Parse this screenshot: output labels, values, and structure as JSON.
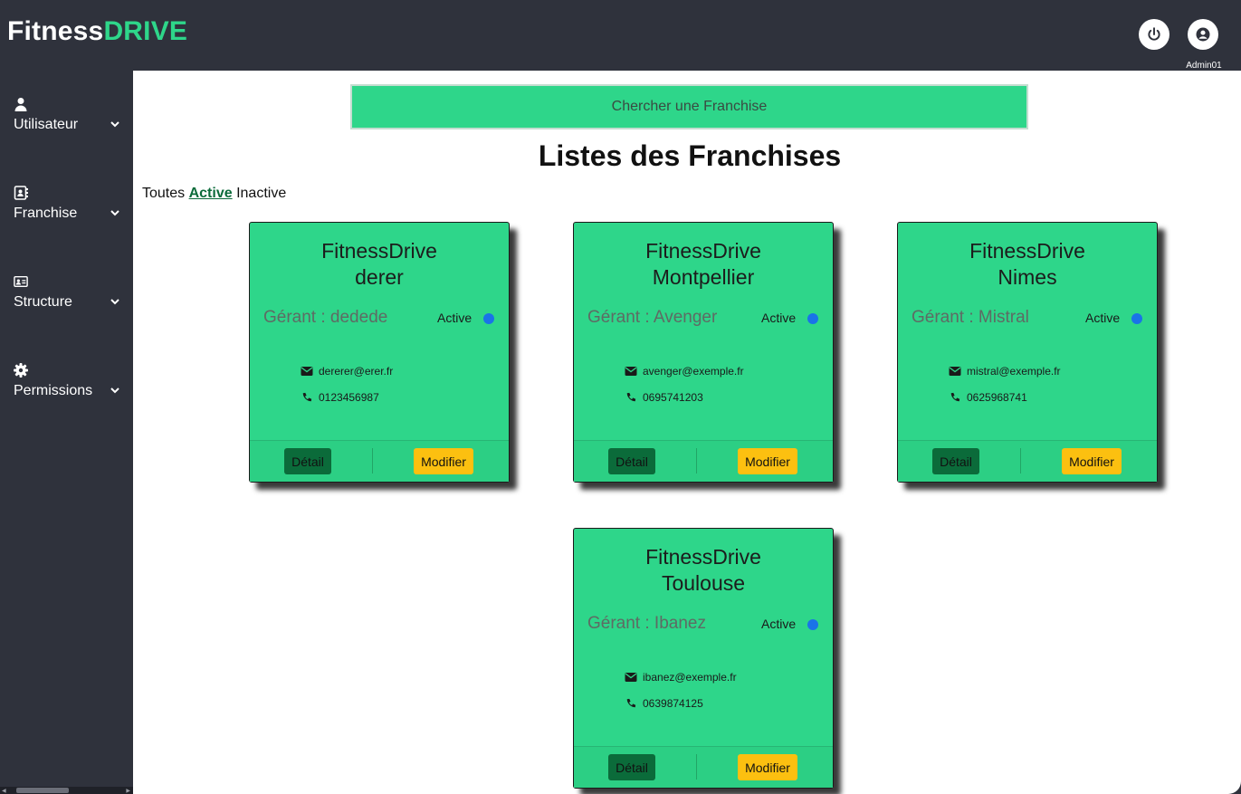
{
  "header": {
    "logo_part1": "Fitness",
    "logo_part2": "DRIVE",
    "power_icon": "power-icon",
    "user_icon": "user-circle-icon",
    "username": "Admin01"
  },
  "sidebar": {
    "items": [
      {
        "label": "Utilisateur",
        "icon": "user-icon"
      },
      {
        "label": "Franchise",
        "icon": "address-book-icon"
      },
      {
        "label": "Structure",
        "icon": "id-card-icon"
      },
      {
        "label": "Permissions",
        "icon": "gear-icon"
      }
    ]
  },
  "main": {
    "search_placeholder": "Chercher une Franchise",
    "title": "Listes des Franchises",
    "filters": {
      "all": "Toutes",
      "active": "Active",
      "inactive": "Inactive",
      "selected": "Active"
    },
    "cards": [
      {
        "name_line1": "FitnessDrive",
        "name_line2": "derer",
        "manager": "Gérant : dedede",
        "status": "Active",
        "email": "dererer@erer.fr",
        "phone": "0123456987",
        "detail_label": "Détail",
        "modify_label": "Modifier"
      },
      {
        "name_line1": "FitnessDrive",
        "name_line2": "Montpellier",
        "manager": "Gérant : Avenger",
        "status": "Active",
        "email": "avenger@exemple.fr",
        "phone": "0695741203",
        "detail_label": "Détail",
        "modify_label": "Modifier"
      },
      {
        "name_line1": "FitnessDrive",
        "name_line2": "Nimes",
        "manager": "Gérant : Mistral",
        "status": "Active",
        "email": "mistral@exemple.fr",
        "phone": "0625968741",
        "detail_label": "Détail",
        "modify_label": "Modifier"
      },
      {
        "name_line1": "FitnessDrive",
        "name_line2": "Toulouse",
        "manager": "Gérant : Ibanez",
        "status": "Active",
        "email": "ibanez@exemple.fr",
        "phone": "0639874125",
        "detail_label": "Détail",
        "modify_label": "Modifier"
      }
    ]
  },
  "colors": {
    "sidebar_bg": "#2f323c",
    "brand_green": "#2ed68a",
    "detail_button": "#0b6b3a",
    "modify_button": "#fcc010",
    "status_dot": "#1a73e8"
  }
}
